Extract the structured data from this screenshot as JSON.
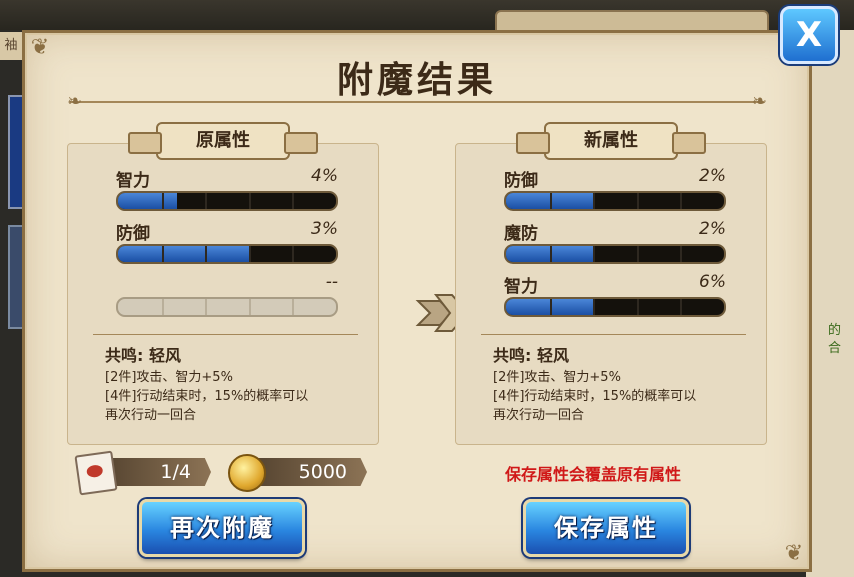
{
  "dialog": {
    "title": "附魔结果",
    "close_label": "X",
    "warning": "保存属性会覆盖原有属性",
    "reenchant_button": "再次附魔",
    "save_button": "保存属性"
  },
  "background": {
    "left_tab": "袖",
    "right_text": "的合"
  },
  "original": {
    "header": "原属性",
    "stats": [
      {
        "name": "智力",
        "value": "4%",
        "fill": 0.27
      },
      {
        "name": "防御",
        "value": "3%",
        "fill": 0.6
      },
      {
        "name": "",
        "value": "--",
        "fill": 0
      }
    ],
    "resonance_title": "共鸣: 轻风",
    "resonance_lines": [
      "[2件]攻击、智力+5%",
      "[4件]行动结束时，15%的概率可以",
      "再次行动一回合"
    ]
  },
  "new": {
    "header": "新属性",
    "stats": [
      {
        "name": "防御",
        "value": "2%",
        "fill": 0.4
      },
      {
        "name": "魔防",
        "value": "2%",
        "fill": 0.4
      },
      {
        "name": "智力",
        "value": "6%",
        "fill": 0.4
      }
    ],
    "resonance_title": "共鸣: 轻风",
    "resonance_lines": [
      "[2件]攻击、智力+5%",
      "[4件]行动结束时，15%的概率可以",
      "再次行动一回合"
    ]
  },
  "costs": {
    "scroll": "1/4",
    "gold": "5000"
  },
  "colors": {
    "bar_fill": "#2f6dc4",
    "button": "#2a86e0",
    "warning": "#d01818"
  }
}
